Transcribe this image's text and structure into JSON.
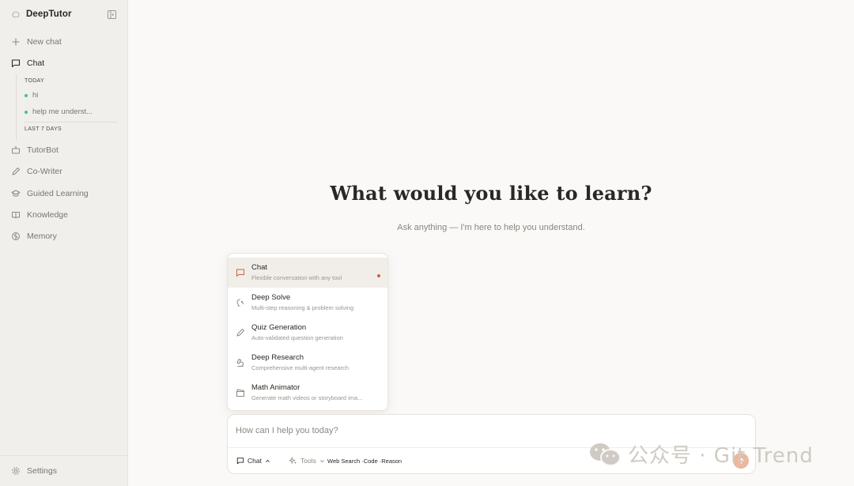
{
  "app": {
    "name": "DeepTutor"
  },
  "sidebar": {
    "new_chat": "New chat",
    "chat": "Chat",
    "history": {
      "today_label": "TODAY",
      "today_items": [
        "hi",
        "help me underst..."
      ],
      "last7_label": "LAST 7 DAYS"
    },
    "items": [
      "TutorBot",
      "Co-Writer",
      "Guided Learning",
      "Knowledge",
      "Memory"
    ],
    "settings": "Settings"
  },
  "hero": {
    "title": "What would you like to learn?",
    "subtitle": "Ask anything — I'm here to help you understand."
  },
  "mode_menu": {
    "items": [
      {
        "title": "Chat",
        "desc": "Flexible conversation with any tool",
        "selected": true
      },
      {
        "title": "Deep Solve",
        "desc": "Multi-step reasoning & problem solving"
      },
      {
        "title": "Quiz Generation",
        "desc": "Auto-validated question generation"
      },
      {
        "title": "Deep Research",
        "desc": "Comprehensive multi-agent research"
      },
      {
        "title": "Math Animator",
        "desc": "Generate math videos or storyboard ima..."
      }
    ]
  },
  "composer": {
    "placeholder": "How can I help you today?",
    "mode_label": "Chat",
    "tools_label": "Tools",
    "tools_summary": "Web Search ·Code ·Reason"
  },
  "watermark": {
    "text": "公众号 · Git Trend"
  },
  "colors": {
    "accent": "#c9623a",
    "history_dot": "#48c08a",
    "sidebar_bg": "#f1efec",
    "page_bg": "#faf9f7"
  }
}
